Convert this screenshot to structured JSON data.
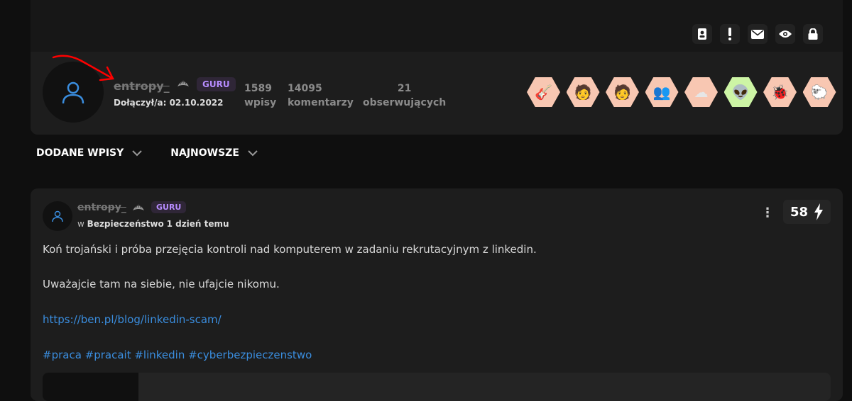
{
  "header": {
    "actions": [
      {
        "icon": "contact-card-icon"
      },
      {
        "icon": "exclamation-icon"
      },
      {
        "icon": "envelope-icon"
      },
      {
        "icon": "eye-icon"
      },
      {
        "icon": "lock-icon"
      }
    ]
  },
  "profile": {
    "username": "entropy_",
    "rank": "GURU",
    "joined": "Dołączył/a: 02.10.2022",
    "stats": [
      {
        "value": "1589",
        "label": "wpisy"
      },
      {
        "value": "14095",
        "label": "komentarzy"
      },
      {
        "value": "21",
        "label": "obserwujących"
      }
    ],
    "achievements": [
      {
        "icon": "rocket-guitar-icon",
        "emoji": "🎸",
        "color": "#f8c7b2"
      },
      {
        "icon": "person-stars-icon",
        "emoji": "🧑",
        "color": "#f8c7b2"
      },
      {
        "icon": "person-stars-icon",
        "emoji": "🧑",
        "color": "#f8c7b2"
      },
      {
        "icon": "two-people-icon",
        "emoji": "👥",
        "color": "#f8c7b2"
      },
      {
        "icon": "cloud-icon",
        "emoji": "☁",
        "color": "#f8c7b2"
      },
      {
        "icon": "astronaut-icon",
        "emoji": "👽",
        "color": "#cdf5a5"
      },
      {
        "icon": "bug-icon",
        "emoji": "🐞",
        "color": "#f8c7b2"
      },
      {
        "icon": "sheep-icon",
        "emoji": "🐑",
        "color": "#f8c7b2"
      }
    ]
  },
  "tabs": [
    {
      "label": "DODANE WPISY"
    },
    {
      "label": "NAJNOWSZE"
    }
  ],
  "post": {
    "author": "entropy_",
    "rank": "GURU",
    "meta_prefix": "w ",
    "category": "Bezpieczeństwo",
    "time": "1 dzień temu",
    "votes": "58",
    "lines": [
      "Koń trojański i próba przejęcia kontroli nad komputerem w zadaniu rekrutacyjnym z linkedin.",
      "Uważajcie tam na siebie, nie ufajcie nikomu."
    ],
    "link": "https://ben.pl/blog/linkedin-scam/",
    "tags": "#praca #pracait #linkedin #cyberbezpieczenstwo"
  },
  "colors": {
    "background": "#0f0f0f",
    "card": "#1d1d1d",
    "accent_badge": "#b78cff",
    "link": "#3a8dde",
    "annotation": "#ff0000"
  }
}
